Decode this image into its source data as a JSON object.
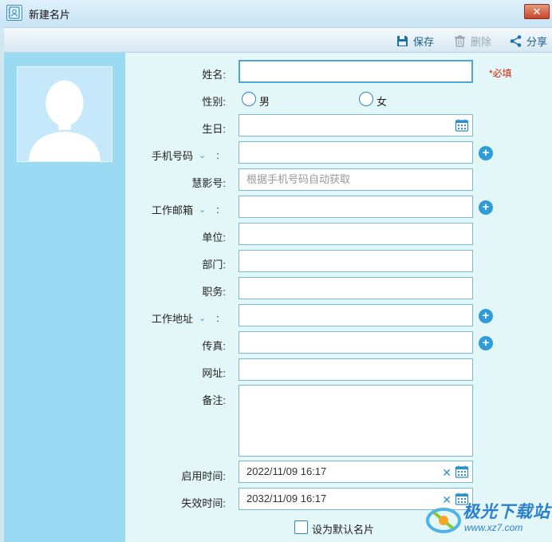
{
  "window": {
    "title": "新建名片",
    "close_label": "✕"
  },
  "toolbar": {
    "save_label": "保存",
    "delete_label": "删除",
    "share_label": "分享"
  },
  "form": {
    "name_label": "姓名:",
    "name_value": "",
    "required_note": "*必填",
    "gender_label": "性别:",
    "gender_male": "男",
    "gender_female": "女",
    "birthday_label": "生日:",
    "mobile_label": "手机号码",
    "mobile_colon": ":",
    "huiying_label": "慧影号:",
    "huiying_placeholder": "根据手机号码自动获取",
    "work_email_label": "工作邮箱",
    "work_email_colon": ":",
    "company_label": "单位:",
    "department_label": "部门:",
    "position_label": "职务:",
    "work_address_label": "工作地址",
    "work_address_colon": ":",
    "fax_label": "传真:",
    "website_label": "网址:",
    "notes_label": "备注:",
    "start_time_label": "启用时间:",
    "start_time_value": "2022/11/09 16:17",
    "expire_time_label": "失效时间:",
    "expire_time_value": "2032/11/09 16:17",
    "default_card_label": "设为默认名片"
  },
  "watermark": {
    "title": "极光下载站",
    "url": "www.xz7.com"
  },
  "colors": {
    "accent": "#2f9cd8",
    "required": "#d81e06",
    "sidebar": "#9adaf3",
    "form_bg": "#e3f6f8"
  },
  "icons": {
    "app": "contact-card-icon",
    "save": "floppy-disk-icon",
    "delete": "trash-icon",
    "share": "share-icon",
    "calendar": "calendar-icon",
    "add": "plus-circle-icon",
    "clear": "clear-x-icon",
    "dropdown": "chevron-down-icon"
  }
}
